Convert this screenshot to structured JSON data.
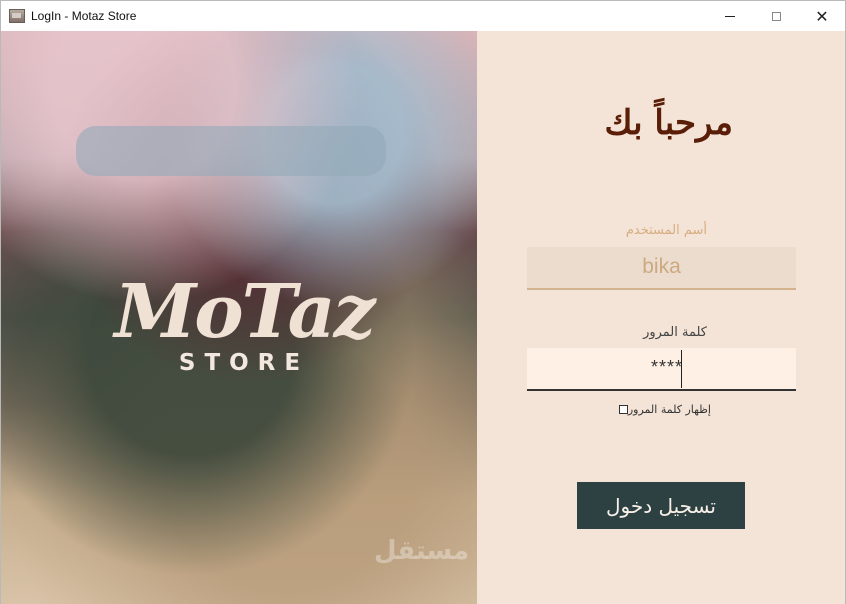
{
  "window": {
    "title": "LogIn - Motaz Store",
    "controls": {
      "minimize": "—",
      "maximize": "□",
      "close": "✕"
    }
  },
  "brand": {
    "logo_main": "MoTaz",
    "logo_sub": "STORE",
    "watermark": "مستقل"
  },
  "form": {
    "welcome": "مرحباً بك",
    "username_label": "أسم المستخدم",
    "username_value": "bika",
    "password_label": "كلمة المرور",
    "password_value": "****",
    "show_password_label": "إظهار كلمة المرور",
    "login_button": "تسجيل دخول"
  },
  "colors": {
    "accent": "#2d4143",
    "panel": "#f4e4d7",
    "title": "#5a1d07"
  }
}
